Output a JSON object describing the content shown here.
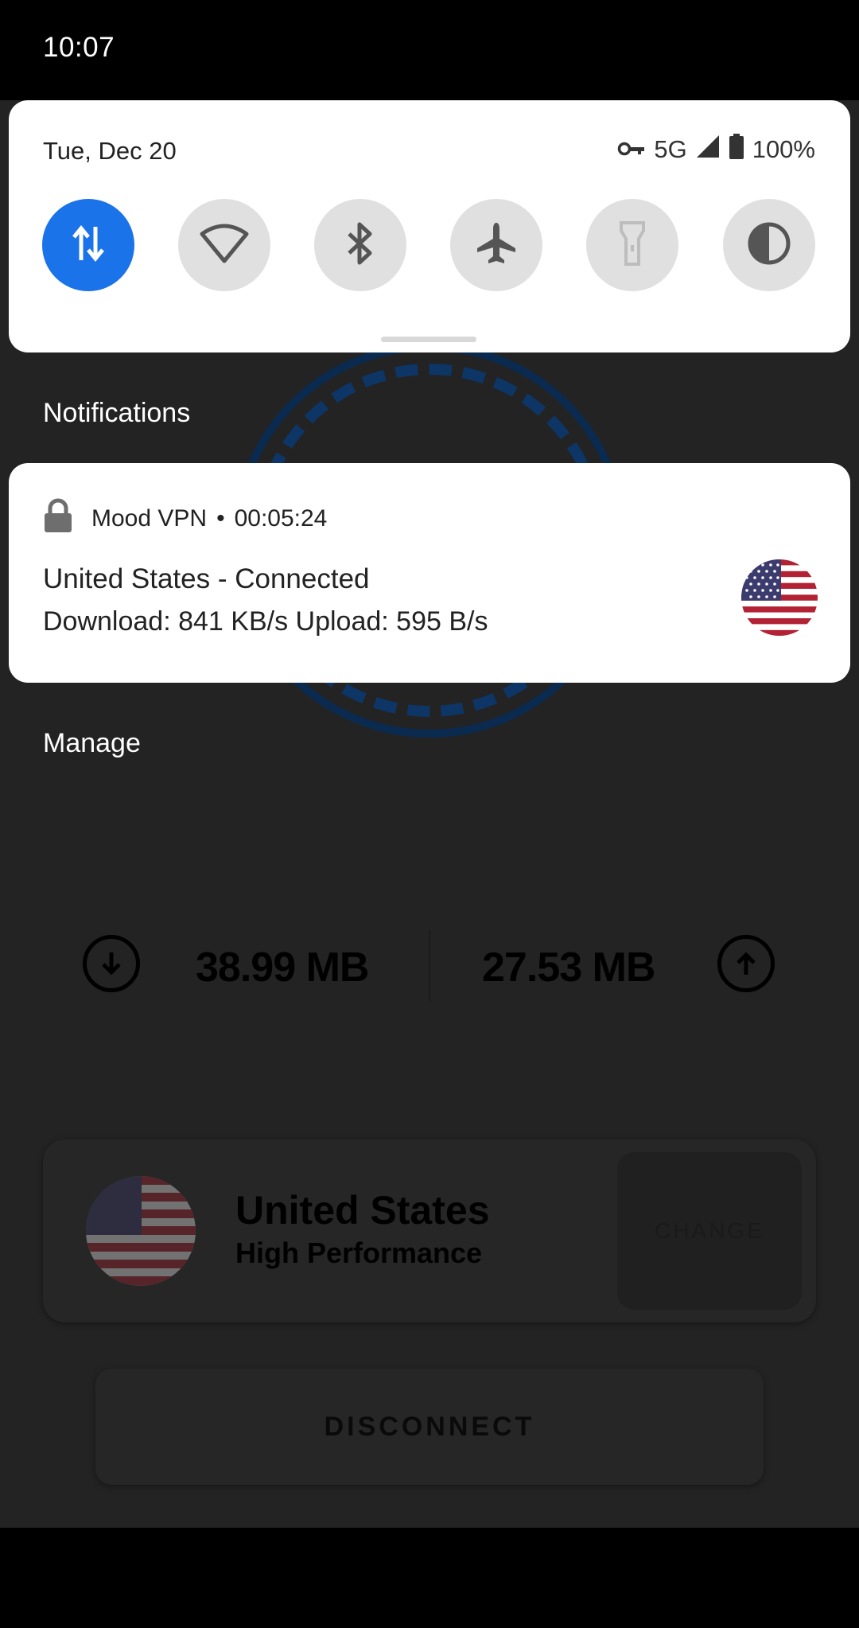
{
  "status_bar": {
    "time": "10:07"
  },
  "quick_settings": {
    "date": "Tue, Dec 20",
    "network": "5G",
    "battery": "100%",
    "tiles": [
      {
        "name": "mobile-data",
        "icon": "data-arrows-icon",
        "active": true
      },
      {
        "name": "wifi",
        "icon": "wifi-icon",
        "active": false
      },
      {
        "name": "bluetooth",
        "icon": "bluetooth-icon",
        "active": false
      },
      {
        "name": "airplane-mode",
        "icon": "airplane-icon",
        "active": false
      },
      {
        "name": "flashlight",
        "icon": "flashlight-icon",
        "active": false
      },
      {
        "name": "invert-colors",
        "icon": "contrast-icon",
        "active": false
      }
    ],
    "colors": {
      "active_tile": "#1a73e8",
      "inactive_tile": "#e0e0e0"
    }
  },
  "notifications": {
    "section_label": "Notifications",
    "items": [
      {
        "app_name": "Mood VPN",
        "separator": "•",
        "elapsed": "00:05:24",
        "title": "United States - Connected",
        "text": "Download: 841 KB/s Upload: 595 B/s",
        "icon": "lock-icon",
        "large_icon": "us-flag-icon"
      }
    ],
    "manage_label": "Manage"
  },
  "app": {
    "download_total": "38.99 MB",
    "upload_total": "27.53 MB",
    "server": {
      "country": "United States",
      "tier": "High Performance",
      "change_label": "CHANGE"
    },
    "disconnect_label": "DISCONNECT"
  }
}
